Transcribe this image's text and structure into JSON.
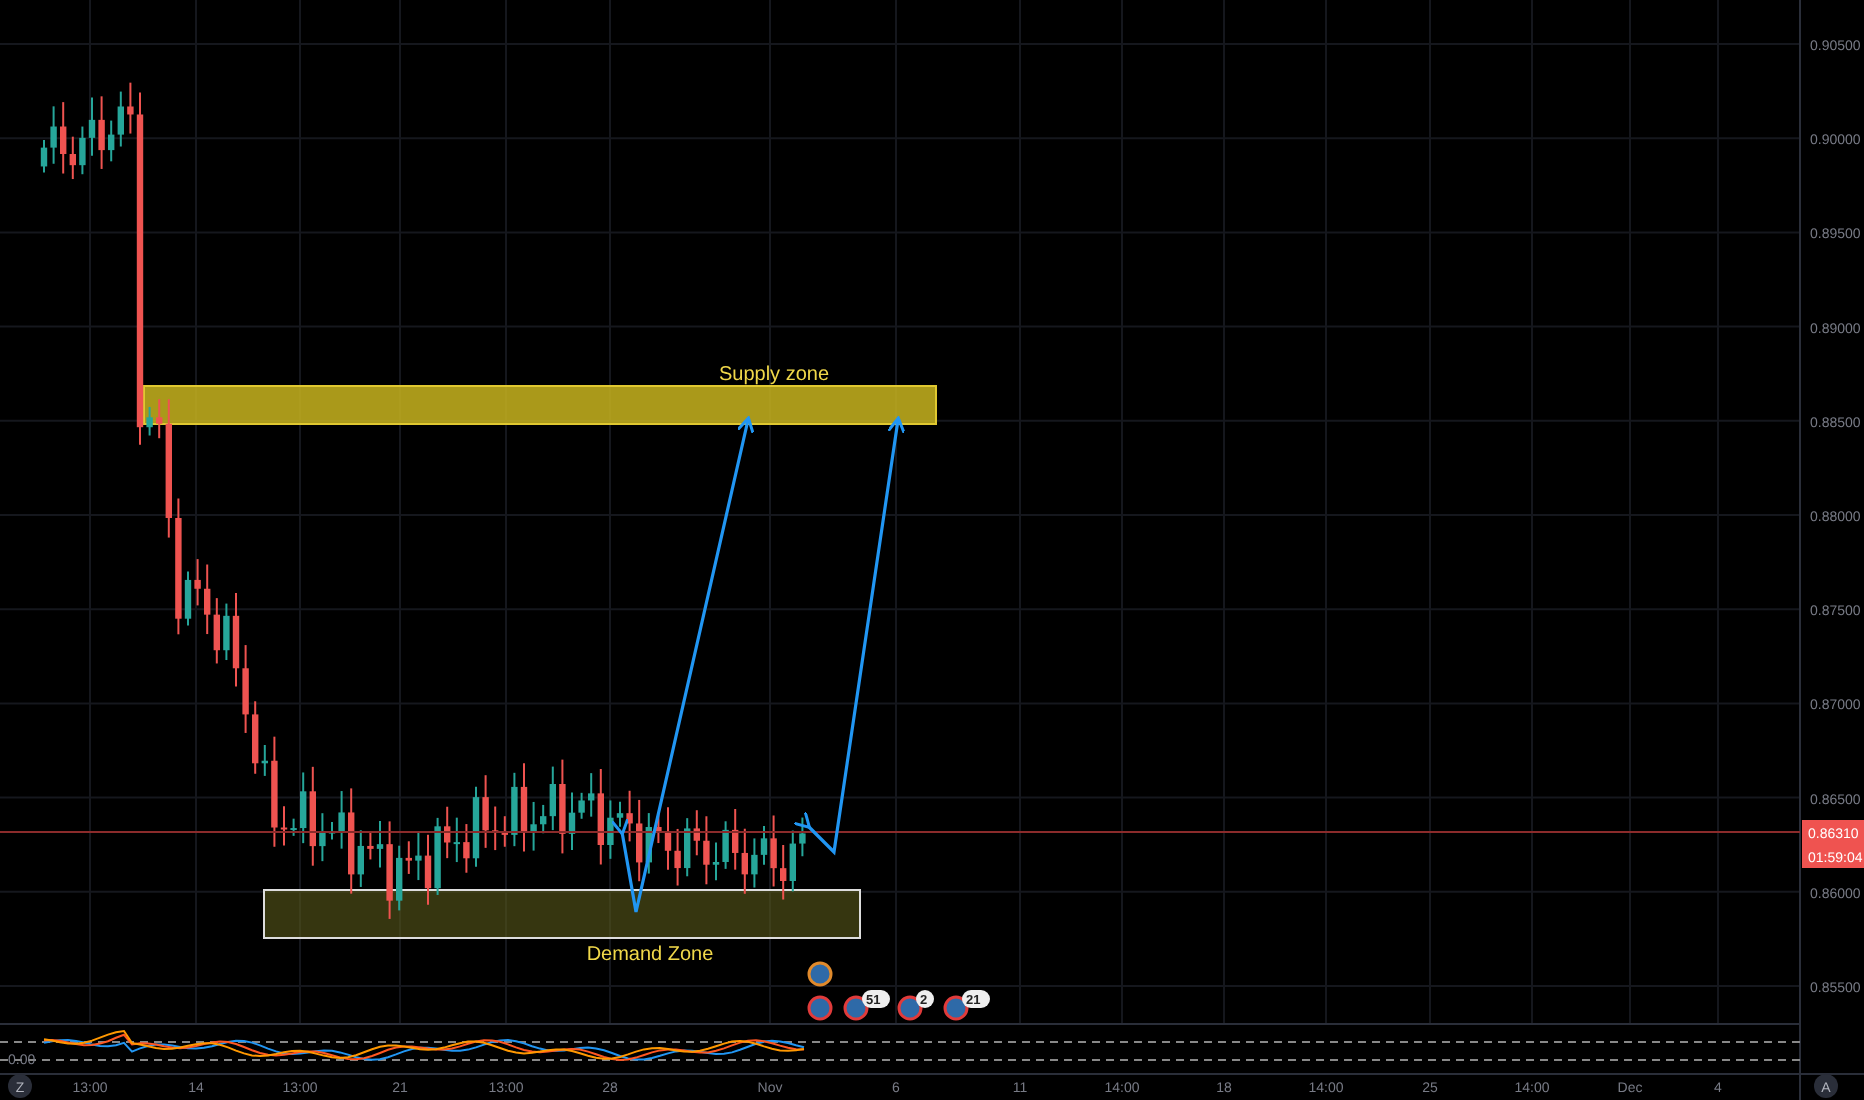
{
  "chart": {
    "price_axis": [
      "0.90500",
      "0.90000",
      "0.89500",
      "0.89000",
      "0.88500",
      "0.88000",
      "0.87500",
      "0.87000",
      "0.86500",
      "0.86000",
      "0.85500"
    ],
    "current_price": "0.86310",
    "countdown": "01:59:04",
    "supply_zone": {
      "label": "Supply zone"
    },
    "demand_zone": {
      "label": "Demand Zone"
    },
    "event_counts": [
      "51",
      "2",
      "21"
    ]
  },
  "oscillator": {
    "zero_label": "0.00"
  },
  "time_axis": [
    "13:00",
    "14",
    "13:00",
    "21",
    "13:00",
    "28",
    "Nov",
    "6",
    "11",
    "14:00",
    "18",
    "14:00",
    "25",
    "14:00",
    "Dec",
    "4"
  ],
  "buttons": {
    "zoom": "Z",
    "auto": "A"
  }
}
